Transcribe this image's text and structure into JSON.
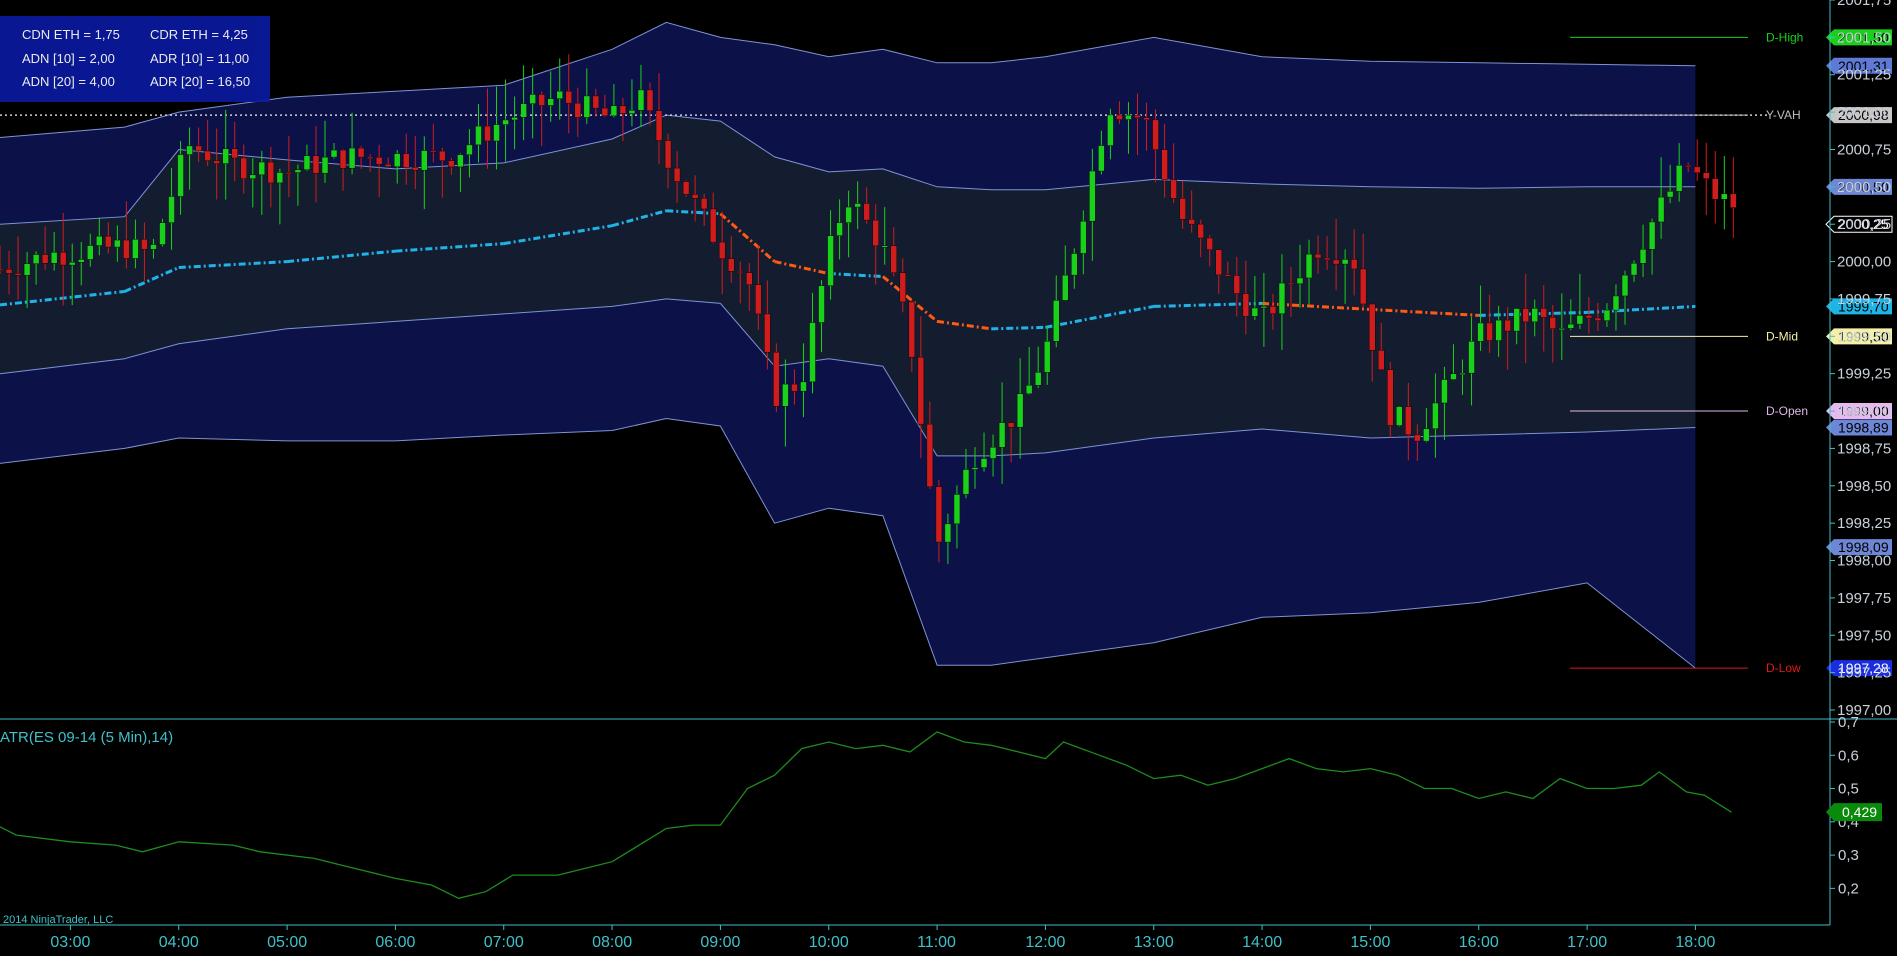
{
  "info_panel": {
    "cdn_eth": "CDN ETH = 1,75",
    "cdr_eth": "CDR ETH = 4,25",
    "adn_10": "ADN [10] = 2,00",
    "adr_10": "ADR [10] = 11,00",
    "adn_20": "ADN [20] = 4,00",
    "adr_20": "ADR [20] = 16,50"
  },
  "indicator_title": "ATR(ES 09-14 (5 Min),14)",
  "copyright": "2014 NinjaTrader, LLC",
  "colors": {
    "background": "#000000",
    "up_candle": "#19d11a",
    "down_candle": "#d01c1c",
    "vwap_up": "#1fb4e6",
    "vwap_down": "#ff5a14",
    "inner_band": "#141c30",
    "outer_band": "#0c1248",
    "band_line": "#7d93d6",
    "atr_line": "#1e8c1e",
    "axis": "#3fc1c9"
  },
  "chart_data": [
    {
      "type": "candlestick",
      "y_ticks": [
        "2001,75",
        "2001,50",
        "2001,25",
        "2001,00",
        "2000,75",
        "2000,50",
        "2000,25",
        "2000,00",
        "1999,75",
        "1999,50",
        "1999,25",
        "1999,00",
        "1998,75",
        "1998,50",
        "1998,25",
        "1998,00",
        "1997,75",
        "1997,50",
        "1997,25",
        "1997,00"
      ],
      "ylim": [
        1997.0,
        2001.75
      ],
      "x_ticks": [
        "03:00",
        "04:00",
        "05:00",
        "06:00",
        "07:00",
        "08:00",
        "09:00",
        "10:00",
        "11:00",
        "12:00",
        "13:00",
        "14:00",
        "15:00",
        "16:00",
        "17:00",
        "18:00"
      ],
      "xlim": [
        "02:21",
        "18:33"
      ],
      "levels": [
        {
          "name": "D-High",
          "value": 2001.5,
          "tag": "2001,50",
          "color": "#19d11a",
          "tag_color": "#19d11a",
          "tag_text_color": "#000000"
        },
        {
          "name": "",
          "value": 2001.31,
          "tag": "2001,31",
          "color": "#7d93d6",
          "tag_color": "#5f7ad6",
          "tag_text_color": "#000000"
        },
        {
          "name": "Y-VAH",
          "value": 2000.98,
          "tag": "2000,98",
          "color": "#bfbfbf",
          "tag_color": "#c6c6c6",
          "tag_text_color": "#000000"
        },
        {
          "name": "",
          "value": 2000.5,
          "tag": "2000,50",
          "color": "#7d93d6",
          "tag_color": "#6d87d6",
          "tag_text_color": "#000000"
        },
        {
          "name": "",
          "value": 2000.25,
          "tag": "2000,25",
          "color": "#ffffff",
          "tag_color": "#000000",
          "tag_text_color": "#ffffff"
        },
        {
          "name": "",
          "value": 1999.7,
          "tag": "1999,70",
          "color": "#1fb4e6",
          "tag_color": "#1fb4e6",
          "tag_text_color": "#000000"
        },
        {
          "name": "D-Mid",
          "value": 1999.5,
          "tag": "1999,50",
          "color": "#f5f0a8",
          "tag_color": "#f5f0a8",
          "tag_text_color": "#000000"
        },
        {
          "name": "D-Open",
          "value": 1999.0,
          "tag": "1999,00",
          "color": "#e0b8e8",
          "tag_color": "#e8b8f0",
          "tag_text_color": "#000000"
        },
        {
          "name": "",
          "value": 1998.89,
          "tag": "1998,89",
          "color": "#7d93d6",
          "tag_color": "#6d87d6",
          "tag_text_color": "#000000"
        },
        {
          "name": "",
          "value": 1998.09,
          "tag": "1998,09",
          "color": "#7d93d6",
          "tag_color": "#6d87d6",
          "tag_text_color": "#000000"
        },
        {
          "name": "D-Low",
          "value": 1997.28,
          "tag": "1997,28",
          "color": "#e01818",
          "tag_color": "#1a2ee0",
          "tag_text_color": "#ffffff"
        }
      ],
      "dotted_line": 2000.98,
      "bands_points": [
        {
          "t": "02:21",
          "vwap": 1999.71,
          "in_hi": 2000.25,
          "in_lo": 1999.25,
          "out_hi": 2000.83,
          "out_lo": 1998.65
        },
        {
          "t": "03:30",
          "vwap": 1999.8,
          "in_hi": 2000.3,
          "in_lo": 1999.35,
          "out_hi": 2000.9,
          "out_lo": 1998.75
        },
        {
          "t": "04:00",
          "vwap": 1999.96,
          "in_hi": 2000.75,
          "in_lo": 1999.45,
          "out_hi": 2001.0,
          "out_lo": 1998.82
        },
        {
          "t": "05:00",
          "vwap": 2000.0,
          "in_hi": 2000.68,
          "in_lo": 1999.55,
          "out_hi": 2001.1,
          "out_lo": 1998.8
        },
        {
          "t": "06:00",
          "vwap": 2000.07,
          "in_hi": 2000.62,
          "in_lo": 1999.6,
          "out_hi": 2001.14,
          "out_lo": 1998.8
        },
        {
          "t": "07:00",
          "vwap": 2000.12,
          "in_hi": 2000.66,
          "in_lo": 1999.65,
          "out_hi": 2001.18,
          "out_lo": 1998.84
        },
        {
          "t": "08:00",
          "vwap": 2000.24,
          "in_hi": 2000.82,
          "in_lo": 1999.7,
          "out_hi": 2001.42,
          "out_lo": 1998.87
        },
        {
          "t": "08:30",
          "vwap": 2000.34,
          "in_hi": 2000.98,
          "in_lo": 1999.75,
          "out_hi": 2001.6,
          "out_lo": 1998.95
        },
        {
          "t": "09:00",
          "vwap": 2000.32,
          "in_hi": 2000.94,
          "in_lo": 1999.72,
          "out_hi": 2001.5,
          "out_lo": 1998.9
        },
        {
          "t": "09:30",
          "vwap": 2000.0,
          "in_hi": 2000.7,
          "in_lo": 1999.3,
          "out_hi": 2001.45,
          "out_lo": 1998.25
        },
        {
          "t": "10:00",
          "vwap": 1999.92,
          "in_hi": 2000.6,
          "in_lo": 1999.35,
          "out_hi": 2001.37,
          "out_lo": 1998.35
        },
        {
          "t": "10:30",
          "vwap": 1999.9,
          "in_hi": 2000.62,
          "in_lo": 1999.3,
          "out_hi": 2001.42,
          "out_lo": 1998.3
        },
        {
          "t": "11:00",
          "vwap": 1999.6,
          "in_hi": 2000.5,
          "in_lo": 1998.7,
          "out_hi": 2001.33,
          "out_lo": 1997.3
        },
        {
          "t": "11:30",
          "vwap": 1999.55,
          "in_hi": 2000.48,
          "in_lo": 1998.7,
          "out_hi": 2001.33,
          "out_lo": 1997.3
        },
        {
          "t": "12:00",
          "vwap": 1999.56,
          "in_hi": 2000.48,
          "in_lo": 1998.72,
          "out_hi": 2001.37,
          "out_lo": 1997.35
        },
        {
          "t": "13:00",
          "vwap": 1999.7,
          "in_hi": 2000.55,
          "in_lo": 1998.82,
          "out_hi": 2001.5,
          "out_lo": 1997.45
        },
        {
          "t": "14:00",
          "vwap": 1999.72,
          "in_hi": 2000.52,
          "in_lo": 1998.88,
          "out_hi": 2001.37,
          "out_lo": 1997.62
        },
        {
          "t": "15:00",
          "vwap": 1999.68,
          "in_hi": 2000.5,
          "in_lo": 1998.82,
          "out_hi": 2001.34,
          "out_lo": 1997.65
        },
        {
          "t": "16:00",
          "vwap": 1999.64,
          "in_hi": 2000.49,
          "in_lo": 1998.84,
          "out_hi": 2001.33,
          "out_lo": 1997.72
        },
        {
          "t": "17:00",
          "vwap": 1999.66,
          "in_hi": 2000.5,
          "in_lo": 1998.86,
          "out_hi": 2001.32,
          "out_lo": 1997.85
        },
        {
          "t": "18:00",
          "vwap": 1999.7,
          "in_hi": 2000.5,
          "in_lo": 1998.89,
          "out_hi": 2001.31,
          "out_lo": 1997.28
        }
      ],
      "price_path": [
        {
          "t": "02:21",
          "p": 1999.95
        },
        {
          "t": "02:50",
          "p": 2000.05
        },
        {
          "t": "03:30",
          "p": 2000.1
        },
        {
          "t": "03:45",
          "p": 2000.05
        },
        {
          "t": "04:05",
          "p": 2000.78
        },
        {
          "t": "04:30",
          "p": 2000.65
        },
        {
          "t": "05:00",
          "p": 2000.6
        },
        {
          "t": "05:30",
          "p": 2000.7
        },
        {
          "t": "06:00",
          "p": 2000.7
        },
        {
          "t": "06:30",
          "p": 2000.7
        },
        {
          "t": "07:00",
          "p": 2000.95
        },
        {
          "t": "07:30",
          "p": 2001.1
        },
        {
          "t": "08:00",
          "p": 2000.95
        },
        {
          "t": "08:15",
          "p": 2001.1
        },
        {
          "t": "08:35",
          "p": 2000.6
        },
        {
          "t": "09:00",
          "p": 2000.1
        },
        {
          "t": "09:15",
          "p": 1999.9
        },
        {
          "t": "09:30",
          "p": 1999.1
        },
        {
          "t": "09:45",
          "p": 1999.2
        },
        {
          "t": "10:00",
          "p": 2000.05
        },
        {
          "t": "10:10",
          "p": 2000.45
        },
        {
          "t": "10:30",
          "p": 2000.1
        },
        {
          "t": "10:45",
          "p": 1999.5
        },
        {
          "t": "11:00",
          "p": 1998.1
        },
        {
          "t": "11:20",
          "p": 1998.7
        },
        {
          "t": "11:45",
          "p": 1999.0
        },
        {
          "t": "12:00",
          "p": 1999.4
        },
        {
          "t": "12:15",
          "p": 2000.05
        },
        {
          "t": "12:35",
          "p": 2001.05
        },
        {
          "t": "12:55",
          "p": 2000.95
        },
        {
          "t": "13:15",
          "p": 2000.3
        },
        {
          "t": "13:45",
          "p": 1999.8
        },
        {
          "t": "14:00",
          "p": 1999.6
        },
        {
          "t": "14:30",
          "p": 2000.1
        },
        {
          "t": "14:50",
          "p": 2000.05
        },
        {
          "t": "15:10",
          "p": 1999.0
        },
        {
          "t": "15:25",
          "p": 1998.85
        },
        {
          "t": "15:45",
          "p": 1999.2
        },
        {
          "t": "16:00",
          "p": 1999.5
        },
        {
          "t": "16:30",
          "p": 1999.65
        },
        {
          "t": "16:45",
          "p": 1999.5
        },
        {
          "t": "17:10",
          "p": 1999.7
        },
        {
          "t": "17:40",
          "p": 2000.35
        },
        {
          "t": "17:55",
          "p": 2000.65
        },
        {
          "t": "18:10",
          "p": 2000.45
        },
        {
          "t": "18:20",
          "p": 2000.38
        }
      ]
    },
    {
      "type": "line",
      "title": "ATR(ES 09-14 (5 Min),14)",
      "y_ticks": [
        "0,7",
        "0,6",
        "0,5",
        "0,4",
        "0,3",
        "0,2"
      ],
      "ylim": [
        0.15,
        0.7
      ],
      "last_value": "0,429",
      "points": [
        {
          "t": "02:21",
          "v": 0.385
        },
        {
          "t": "02:30",
          "v": 0.36
        },
        {
          "t": "03:00",
          "v": 0.34
        },
        {
          "t": "03:25",
          "v": 0.33
        },
        {
          "t": "03:40",
          "v": 0.31
        },
        {
          "t": "04:00",
          "v": 0.34
        },
        {
          "t": "04:30",
          "v": 0.33
        },
        {
          "t": "04:45",
          "v": 0.31
        },
        {
          "t": "05:15",
          "v": 0.29
        },
        {
          "t": "05:30",
          "v": 0.27
        },
        {
          "t": "06:00",
          "v": 0.23
        },
        {
          "t": "06:20",
          "v": 0.21
        },
        {
          "t": "06:35",
          "v": 0.17
        },
        {
          "t": "06:50",
          "v": 0.19
        },
        {
          "t": "07:05",
          "v": 0.24
        },
        {
          "t": "07:30",
          "v": 0.24
        },
        {
          "t": "07:45",
          "v": 0.26
        },
        {
          "t": "08:00",
          "v": 0.28
        },
        {
          "t": "08:15",
          "v": 0.33
        },
        {
          "t": "08:30",
          "v": 0.38
        },
        {
          "t": "08:45",
          "v": 0.39
        },
        {
          "t": "09:00",
          "v": 0.39
        },
        {
          "t": "09:15",
          "v": 0.5
        },
        {
          "t": "09:30",
          "v": 0.54
        },
        {
          "t": "09:45",
          "v": 0.62
        },
        {
          "t": "10:00",
          "v": 0.64
        },
        {
          "t": "10:15",
          "v": 0.62
        },
        {
          "t": "10:30",
          "v": 0.63
        },
        {
          "t": "10:45",
          "v": 0.61
        },
        {
          "t": "11:00",
          "v": 0.67
        },
        {
          "t": "11:15",
          "v": 0.64
        },
        {
          "t": "11:30",
          "v": 0.63
        },
        {
          "t": "11:45",
          "v": 0.61
        },
        {
          "t": "12:00",
          "v": 0.59
        },
        {
          "t": "12:10",
          "v": 0.64
        },
        {
          "t": "12:30",
          "v": 0.6
        },
        {
          "t": "12:45",
          "v": 0.57
        },
        {
          "t": "13:00",
          "v": 0.53
        },
        {
          "t": "13:15",
          "v": 0.54
        },
        {
          "t": "13:30",
          "v": 0.51
        },
        {
          "t": "13:45",
          "v": 0.53
        },
        {
          "t": "14:00",
          "v": 0.56
        },
        {
          "t": "14:15",
          "v": 0.59
        },
        {
          "t": "14:30",
          "v": 0.56
        },
        {
          "t": "14:45",
          "v": 0.55
        },
        {
          "t": "15:00",
          "v": 0.56
        },
        {
          "t": "15:15",
          "v": 0.54
        },
        {
          "t": "15:30",
          "v": 0.5
        },
        {
          "t": "15:45",
          "v": 0.5
        },
        {
          "t": "16:00",
          "v": 0.47
        },
        {
          "t": "16:15",
          "v": 0.49
        },
        {
          "t": "16:30",
          "v": 0.47
        },
        {
          "t": "16:45",
          "v": 0.53
        },
        {
          "t": "17:00",
          "v": 0.5
        },
        {
          "t": "17:15",
          "v": 0.5
        },
        {
          "t": "17:30",
          "v": 0.51
        },
        {
          "t": "17:40",
          "v": 0.55
        },
        {
          "t": "17:55",
          "v": 0.49
        },
        {
          "t": "18:05",
          "v": 0.48
        },
        {
          "t": "18:20",
          "v": 0.429
        }
      ]
    }
  ]
}
